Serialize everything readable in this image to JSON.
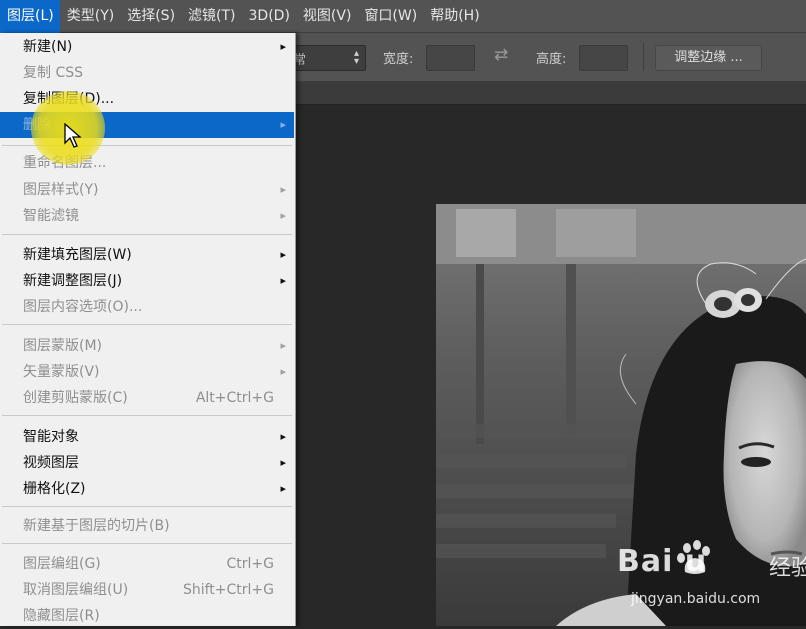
{
  "menubar": {
    "items": [
      {
        "label": "图层(L)",
        "active": true
      },
      {
        "label": "类型(Y)"
      },
      {
        "label": "选择(S)"
      },
      {
        "label": "滤镜(T)"
      },
      {
        "label": "3D(D)"
      },
      {
        "label": "视图(V)"
      },
      {
        "label": "窗口(W)"
      },
      {
        "label": "帮助(H)"
      }
    ]
  },
  "options": {
    "style_value": "常",
    "width_label": "宽度:",
    "height_label": "高度:",
    "refine_label": "调整边缘 ..."
  },
  "menu": {
    "items": [
      {
        "label": "新建(N)",
        "shortcut": "",
        "submenu": true,
        "enabled": true
      },
      {
        "label": "复制 CSS",
        "shortcut": "",
        "submenu": false,
        "enabled": false
      },
      {
        "label": "复制图层(D)...",
        "shortcut": "",
        "submenu": false,
        "enabled": true
      },
      {
        "label": "删除",
        "shortcut": "",
        "submenu": true,
        "enabled": false,
        "highlighted": true
      },
      {
        "label": "重命名图层...",
        "shortcut": "",
        "submenu": false,
        "enabled": false
      },
      {
        "label": "图层样式(Y)",
        "shortcut": "",
        "submenu": true,
        "enabled": false
      },
      {
        "label": "智能滤镜",
        "shortcut": "",
        "submenu": true,
        "enabled": false
      },
      {
        "label": "新建填充图层(W)",
        "shortcut": "",
        "submenu": true,
        "enabled": true
      },
      {
        "label": "新建调整图层(J)",
        "shortcut": "",
        "submenu": true,
        "enabled": true
      },
      {
        "label": "图层内容选项(O)...",
        "shortcut": "",
        "submenu": false,
        "enabled": false
      },
      {
        "label": "图层蒙版(M)",
        "shortcut": "",
        "submenu": true,
        "enabled": false
      },
      {
        "label": "矢量蒙版(V)",
        "shortcut": "",
        "submenu": true,
        "enabled": false
      },
      {
        "label": "创建剪贴蒙版(C)",
        "shortcut": "Alt+Ctrl+G",
        "submenu": false,
        "enabled": false
      },
      {
        "label": "智能对象",
        "shortcut": "",
        "submenu": true,
        "enabled": true
      },
      {
        "label": "视频图层",
        "shortcut": "",
        "submenu": true,
        "enabled": true
      },
      {
        "label": "栅格化(Z)",
        "shortcut": "",
        "submenu": true,
        "enabled": true
      },
      {
        "label": "新建基于图层的切片(B)",
        "shortcut": "",
        "submenu": false,
        "enabled": false
      },
      {
        "label": "图层编组(G)",
        "shortcut": "Ctrl+G",
        "submenu": false,
        "enabled": false
      },
      {
        "label": "取消图层编组(U)",
        "shortcut": "Shift+Ctrl+G",
        "submenu": false,
        "enabled": false
      },
      {
        "label": "隐藏图层(R)",
        "shortcut": "",
        "submenu": false,
        "enabled": false
      }
    ]
  },
  "submenu_glyph": "▸",
  "watermark": {
    "brand": "Bai  u",
    "jingyan": "经验",
    "url": "jingyan.baidu.com"
  },
  "colors": {
    "menubar_bg": "#535353",
    "highlight": "#0b68c8",
    "menu_bg": "#f0f0f0",
    "canvas_bg": "#282828",
    "cursor_highlight": "#f0e114"
  },
  "icons": {
    "swap": "swap-arrows-icon",
    "cursor": "arrow-cursor-icon",
    "logo": "baidu-paw-icon"
  }
}
